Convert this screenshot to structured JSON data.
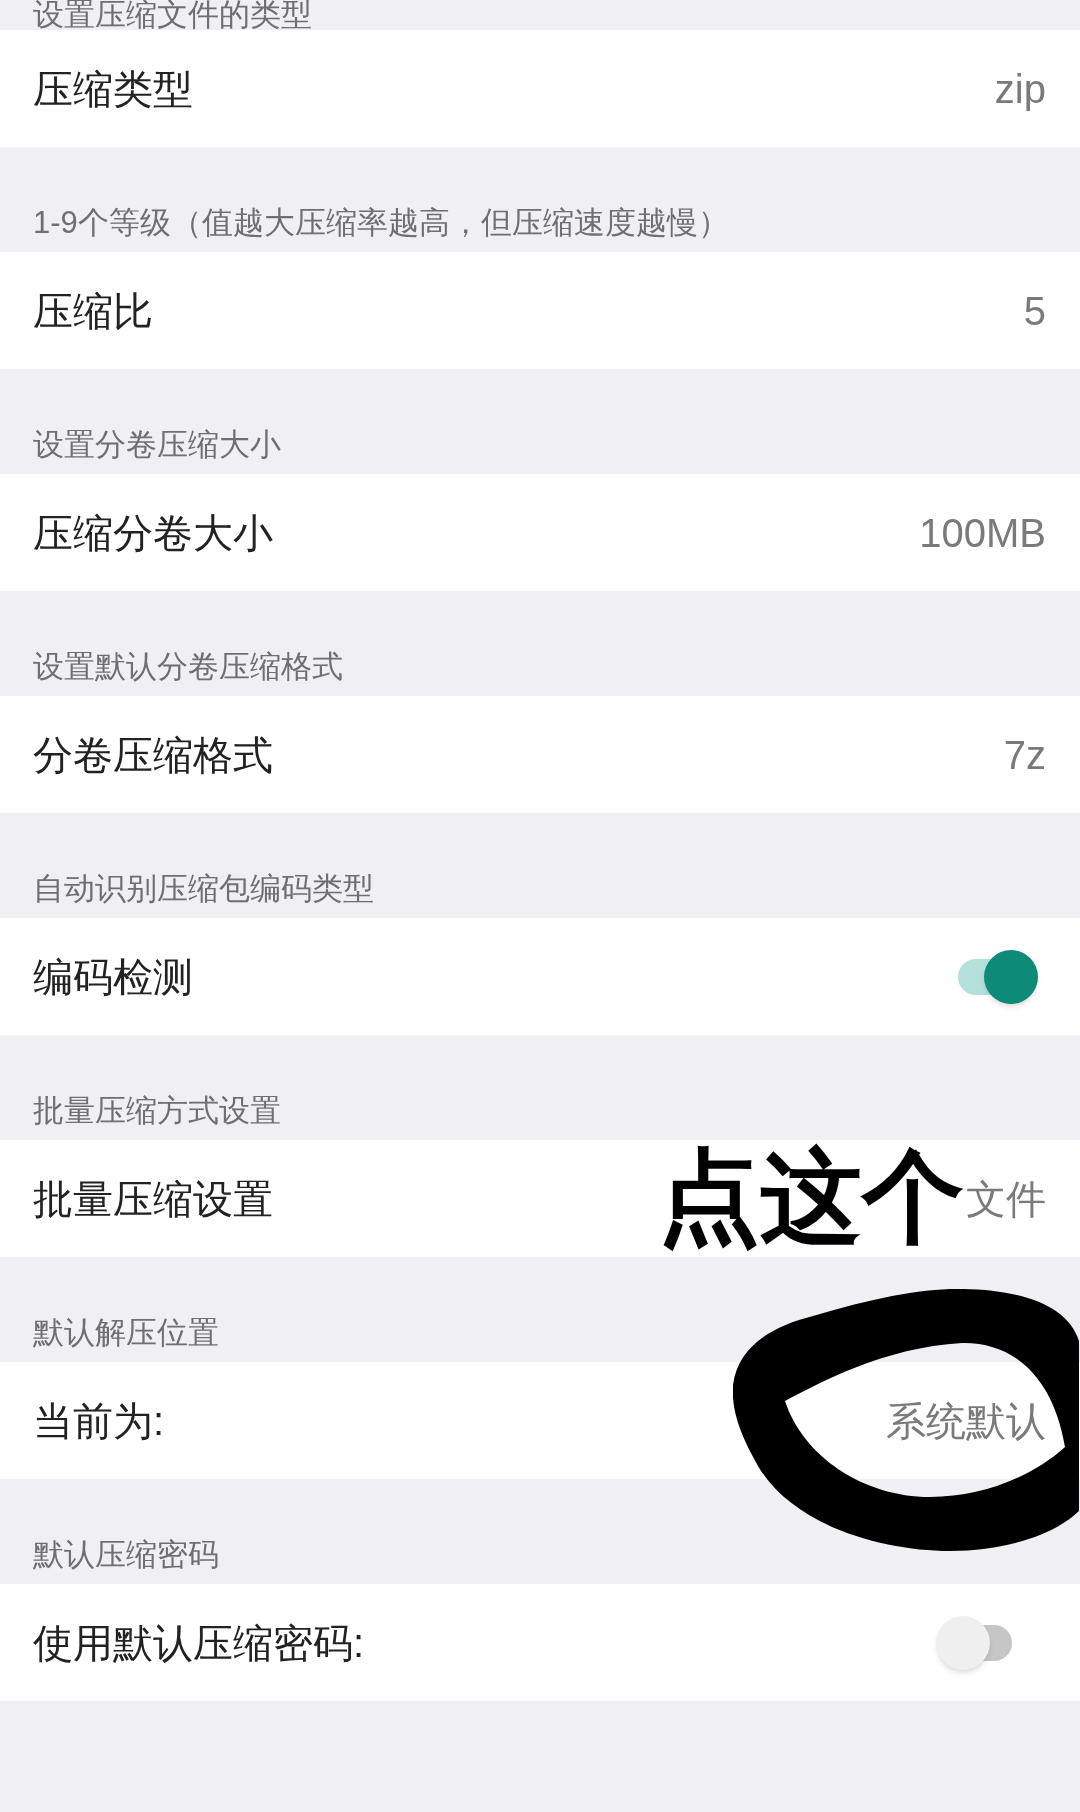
{
  "sections": [
    {
      "header": "设置压缩文件的类型",
      "row": {
        "kind": "value",
        "title": "压缩类型",
        "value": "zip"
      }
    },
    {
      "header": "1-9个等级（值越大压缩率越高，但压缩速度越慢）",
      "row": {
        "kind": "value",
        "title": "压缩比",
        "value": "5"
      }
    },
    {
      "header": "设置分卷压缩大小",
      "row": {
        "kind": "value",
        "title": "压缩分卷大小",
        "value": "100MB"
      }
    },
    {
      "header": "设置默认分卷压缩格式",
      "row": {
        "kind": "value",
        "title": "分卷压缩格式",
        "value": "7z"
      }
    },
    {
      "header": "自动识别压缩包编码类型",
      "row": {
        "kind": "toggle",
        "title": "编码检测",
        "on": true
      }
    },
    {
      "header": "批量压缩方式设置",
      "row": {
        "kind": "value",
        "title": "批量压缩设置",
        "value": "文件",
        "annotation": "点这个"
      }
    },
    {
      "header": "默认解压位置",
      "row": {
        "kind": "value",
        "title": "当前为:",
        "value": "系统默认",
        "circled": true
      }
    },
    {
      "header": "默认压缩密码",
      "row": {
        "kind": "toggle",
        "title": "使用默认压缩密码:",
        "on": false
      }
    }
  ]
}
